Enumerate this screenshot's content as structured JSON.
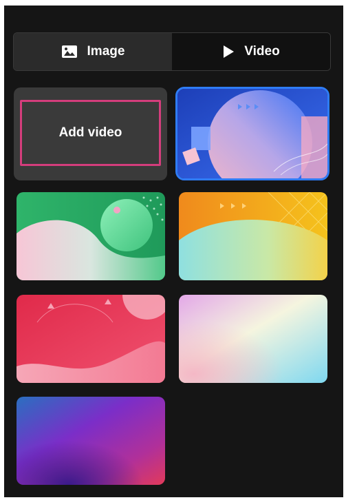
{
  "tabs": [
    {
      "label": "Image",
      "icon": "image-icon",
      "active": false
    },
    {
      "label": "Video",
      "icon": "play-icon",
      "active": true
    }
  ],
  "add_video": {
    "label": "Add video"
  },
  "thumbnails": [
    {
      "name": "video-thumbnail-blue-circle",
      "selected": true
    },
    {
      "name": "video-thumbnail-green-hills",
      "selected": false
    },
    {
      "name": "video-thumbnail-yellow-waves",
      "selected": false
    },
    {
      "name": "video-thumbnail-red-waves",
      "selected": false
    },
    {
      "name": "video-thumbnail-pastel-gradient",
      "selected": false
    },
    {
      "name": "video-thumbnail-purple-gradient",
      "selected": false
    }
  ],
  "colors": {
    "background": "#151515",
    "accent_selected": "#2f7cf6",
    "add_border": "#d43d7c"
  }
}
